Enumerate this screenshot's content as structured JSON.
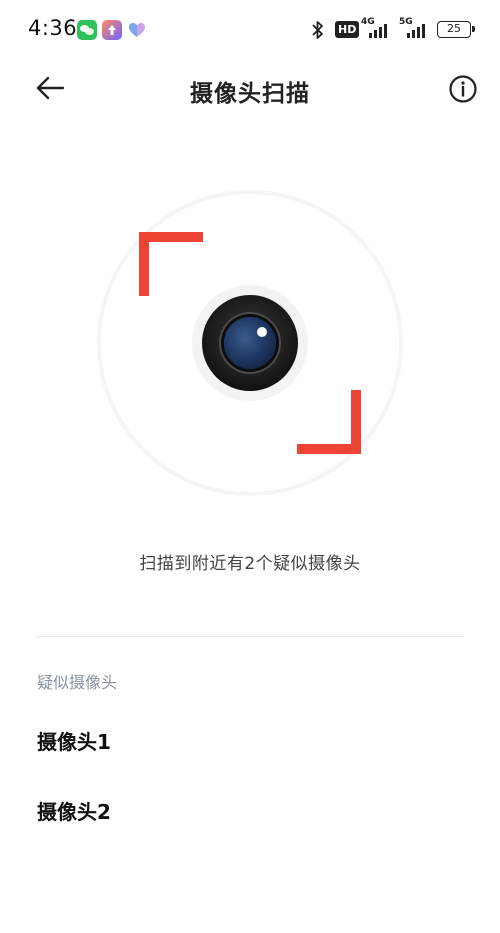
{
  "status_bar": {
    "time": "4:36",
    "hd_badge": "HD",
    "network_1": "4G",
    "network_2": "5G",
    "battery": "25",
    "icons": [
      "wechat-icon",
      "upload-icon",
      "heart-icon",
      "bluetooth-icon",
      "signal-icon",
      "battery-icon"
    ]
  },
  "header": {
    "title": "摄像头扫描",
    "back_icon": "arrow-left-icon",
    "info_icon": "info-icon"
  },
  "scanner": {
    "accent_color": "#ee4433",
    "lens_icon": "camera-lens-icon"
  },
  "scan_result": "扫描到附近有2个疑似摄像头",
  "cameras": {
    "section_title": "疑似摄像头",
    "items": [
      {
        "label": "摄像头1"
      },
      {
        "label": "摄像头2"
      }
    ]
  }
}
